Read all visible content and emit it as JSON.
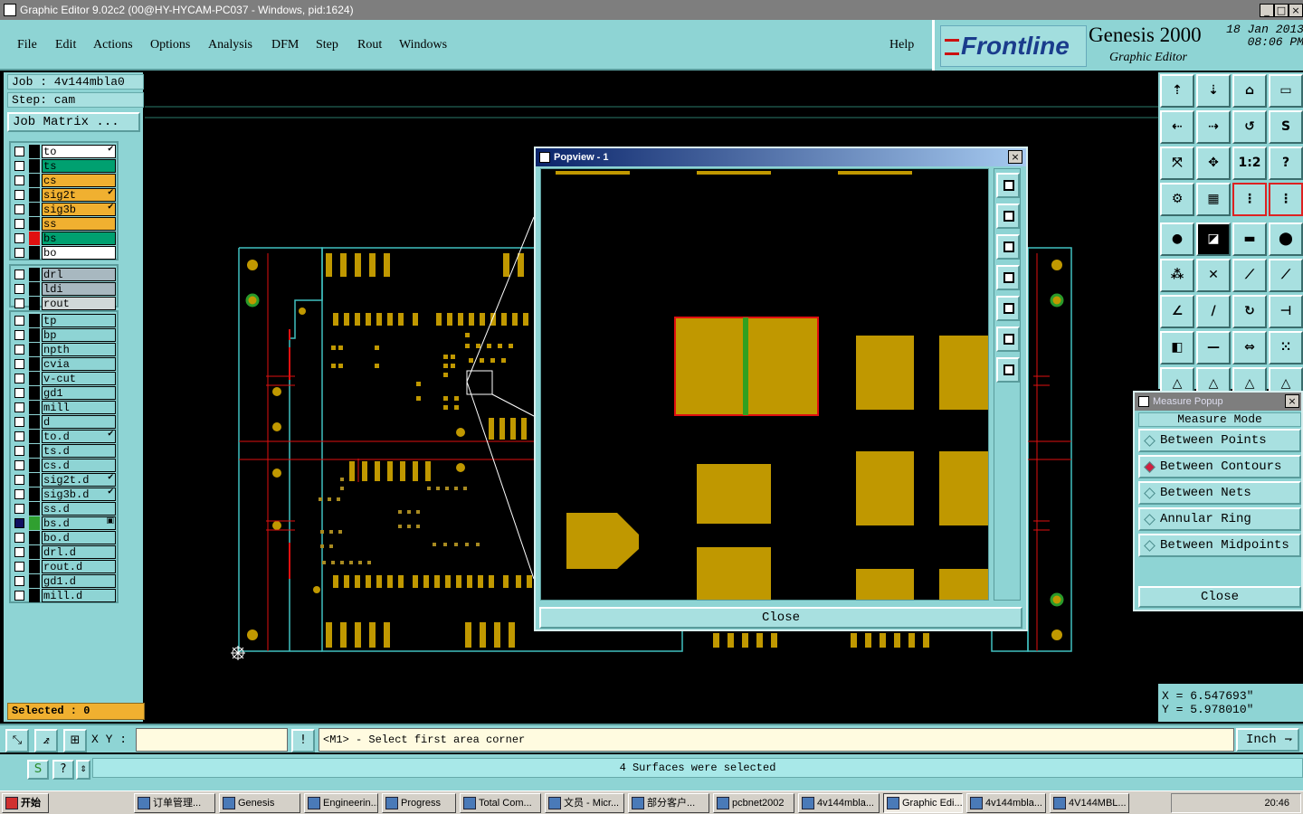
{
  "window": {
    "title": "Graphic Editor 9.02c2 (00@HY-HYCAM-PC037 - Windows, pid:1624)"
  },
  "menu": {
    "items": [
      "File",
      "Edit",
      "Actions",
      "Options",
      "Analysis",
      "DFM",
      "Step",
      "Rout",
      "Windows"
    ],
    "help": "Help"
  },
  "brand": {
    "logo": "Frontline",
    "product": "Genesis 2000",
    "subtitle": "Graphic Editor",
    "date": "18 Jan 2013",
    "time": "08:06 PM"
  },
  "job": {
    "job_label": "Job : 4v144mbla0",
    "step_label": "Step: cam",
    "matrix_button": "Job Matrix ..."
  },
  "layers": {
    "group1": [
      {
        "name": "to",
        "color": "#ffffff",
        "mark": "#000000",
        "tick": "✔"
      },
      {
        "name": "ts",
        "color": "#00a070",
        "mark": "#000000",
        "tick": ""
      },
      {
        "name": "cs",
        "color": "#f0b030",
        "mark": "#000000",
        "tick": ""
      },
      {
        "name": "sig2t",
        "color": "#f0b030",
        "mark": "#000000",
        "tick": "✔"
      },
      {
        "name": "sig3b",
        "color": "#f0b030",
        "mark": "#000000",
        "tick": "✔"
      },
      {
        "name": "ss",
        "color": "#f0b030",
        "mark": "#000000",
        "tick": ""
      },
      {
        "name": "bs",
        "color": "#00a070",
        "mark": "#e01010",
        "tick": ""
      },
      {
        "name": "bo",
        "color": "#ffffff",
        "mark": "#000000",
        "tick": ""
      }
    ],
    "group2": [
      {
        "name": "drl",
        "color": "#a8b8c0",
        "mark": "#000000",
        "tick": ""
      },
      {
        "name": "ldi",
        "color": "#a8b8c0",
        "mark": "#000000",
        "tick": ""
      },
      {
        "name": "rout",
        "color": "#d0d8d8",
        "mark": "#000000",
        "tick": ""
      }
    ],
    "group3": [
      {
        "name": "tp",
        "color": "#8ed4d4",
        "mark": "#000000",
        "tick": ""
      },
      {
        "name": "bp",
        "color": "#8ed4d4",
        "mark": "#000000",
        "tick": ""
      },
      {
        "name": "npth",
        "color": "#8ed4d4",
        "mark": "#000000",
        "tick": ""
      },
      {
        "name": "cvia",
        "color": "#8ed4d4",
        "mark": "#000000",
        "tick": ""
      },
      {
        "name": "v-cut",
        "color": "#8ed4d4",
        "mark": "#000000",
        "tick": ""
      },
      {
        "name": "gd1",
        "color": "#8ed4d4",
        "mark": "#000000",
        "tick": ""
      },
      {
        "name": "mill",
        "color": "#8ed4d4",
        "mark": "#000000",
        "tick": ""
      },
      {
        "name": "d",
        "color": "#8ed4d4",
        "mark": "#000000",
        "tick": ""
      },
      {
        "name": "to.d",
        "color": "#8ed4d4",
        "mark": "#000000",
        "tick": "✔"
      },
      {
        "name": "ts.d",
        "color": "#8ed4d4",
        "mark": "#000000",
        "tick": ""
      },
      {
        "name": "cs.d",
        "color": "#8ed4d4",
        "mark": "#000000",
        "tick": ""
      },
      {
        "name": "sig2t.d",
        "color": "#8ed4d4",
        "mark": "#000000",
        "tick": "✔"
      },
      {
        "name": "sig3b.d",
        "color": "#8ed4d4",
        "mark": "#000000",
        "tick": "✔"
      },
      {
        "name": "ss.d",
        "color": "#8ed4d4",
        "mark": "#000000",
        "tick": ""
      },
      {
        "name": "bs.d",
        "color": "#8ed4d4",
        "mark": "#30a030",
        "tick": "▣",
        "checked": true
      },
      {
        "name": "bo.d",
        "color": "#8ed4d4",
        "mark": "#000000",
        "tick": ""
      },
      {
        "name": "drl.d",
        "color": "#8ed4d4",
        "mark": "#000000",
        "tick": ""
      },
      {
        "name": "rout.d",
        "color": "#8ed4d4",
        "mark": "#000000",
        "tick": ""
      },
      {
        "name": "gd1.d",
        "color": "#8ed4d4",
        "mark": "#000000",
        "tick": ""
      },
      {
        "name": "mill.d",
        "color": "#8ed4d4",
        "mark": "#000000",
        "tick": ""
      }
    ]
  },
  "selected": "Selected : 0",
  "popview": {
    "title": "Popview - 1",
    "close": "Close"
  },
  "measure": {
    "title": "Measure Popup",
    "header": "Measure Mode",
    "options": [
      "Between Points",
      "Between Contours",
      "Between Nets",
      "Annular Ring",
      "Between Midpoints"
    ],
    "selected_index": 1,
    "close": "Close"
  },
  "coords": {
    "x": "X = 6.547693\"",
    "y": "Y = 5.978010\""
  },
  "command": {
    "xy_label": "X Y :",
    "xy_value": "",
    "prompt": "<M1> - Select first area corner",
    "unit": "Inch"
  },
  "status": {
    "message": "4 Surfaces were selected"
  },
  "taskbar": {
    "start": "开始",
    "tasks": [
      "订单管理...",
      "Genesis",
      "Engineerin...",
      "Progress",
      "Total Com...",
      "文员 - Micr...",
      "部分客户...",
      "pcbnet2002",
      "4v144mbla...",
      "Graphic Edi...",
      "4v144mbla...",
      "4V144MBL..."
    ],
    "active_index": 9,
    "clock": "20:46"
  },
  "colors": {
    "panel": "#8ed4d4",
    "pad": "#c09800",
    "outline": "#40c0c0",
    "rout": "#e01010",
    "highlight": "#e01010"
  }
}
